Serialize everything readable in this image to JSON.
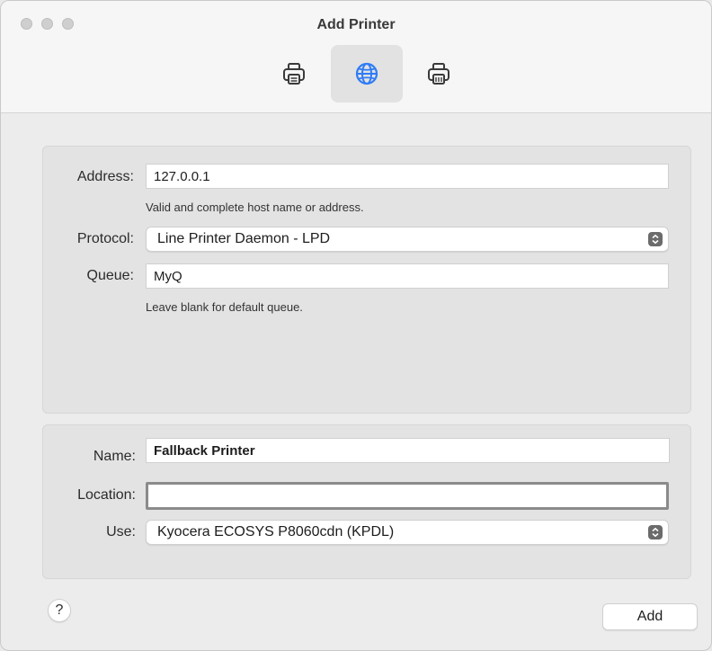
{
  "window": {
    "title": "Add Printer"
  },
  "toolbar": {
    "buttons": [
      {
        "icon": "printer-icon",
        "selected": false
      },
      {
        "icon": "globe-icon",
        "selected": true
      },
      {
        "icon": "printer-list-icon",
        "selected": false
      }
    ],
    "accent_color": "#2f7cf6"
  },
  "connection": {
    "address_label": "Address:",
    "address_value": "127.0.0.1",
    "address_hint": "Valid and complete host name or address.",
    "protocol_label": "Protocol:",
    "protocol_value": "Line Printer Daemon - LPD",
    "queue_label": "Queue:",
    "queue_value": "MyQ",
    "queue_hint": "Leave blank for default queue."
  },
  "details": {
    "name_label": "Name:",
    "name_value": "Fallback Printer",
    "location_label": "Location:",
    "location_value": "",
    "use_label": "Use:",
    "use_value": "Kyocera ECOSYS P8060cdn (KPDL)"
  },
  "footer": {
    "help_label": "?",
    "add_label": "Add"
  }
}
